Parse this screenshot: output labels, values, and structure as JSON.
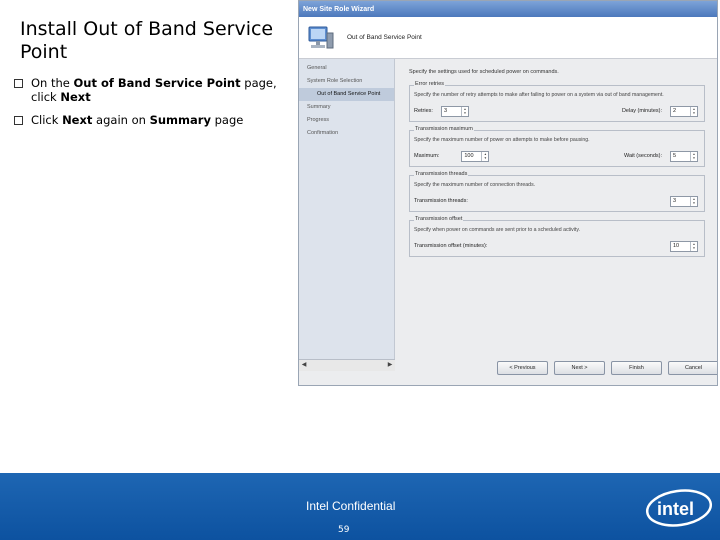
{
  "slide": {
    "title": "Install Out of Band Service Point",
    "bullets": [
      {
        "parts": [
          {
            "text": "On the ",
            "bold": false
          },
          {
            "text": "Out of Band Service Point",
            "bold": true
          },
          {
            "text": " page, click ",
            "bold": false
          },
          {
            "text": "Next",
            "bold": true
          }
        ]
      },
      {
        "parts": [
          {
            "text": "Click ",
            "bold": false
          },
          {
            "text": "Next",
            "bold": true
          },
          {
            "text": " again on ",
            "bold": false
          },
          {
            "text": "Summary",
            "bold": true
          },
          {
            "text": " page",
            "bold": false
          }
        ]
      }
    ]
  },
  "wizard": {
    "window_title": "New Site Role Wizard",
    "header_title": "Out of Band Service Point",
    "nav": [
      {
        "label": "General",
        "active": false,
        "sub": false
      },
      {
        "label": "System Role Selection",
        "active": false,
        "sub": false
      },
      {
        "label": "Out of Band Service Point",
        "active": true,
        "sub": true
      },
      {
        "label": "Summary",
        "active": false,
        "sub": false
      },
      {
        "label": "Progress",
        "active": false,
        "sub": false
      },
      {
        "label": "Confirmation",
        "active": false,
        "sub": false
      }
    ],
    "intro": "Specify the settings used for scheduled power on commands.",
    "groups": {
      "error_retries": {
        "label": "Error retries",
        "desc": "Specify the number of retry attempts to make after failing to power on a system via out of band management.",
        "retries_label": "Retries:",
        "retries_value": "3",
        "delay_label": "Delay (minutes):",
        "delay_value": "2"
      },
      "transmission_maximum": {
        "label": "Transmission maximum",
        "desc": "Specify the maximum number of power on attempts to make before pausing.",
        "maximum_label": "Maximum:",
        "maximum_value": "100",
        "wait_label": "Wait (seconds):",
        "wait_value": "5"
      },
      "transmission_threads": {
        "label": "Transmission threads",
        "desc": "Specify the maximum number of connection threads.",
        "threads_label": "Transmission threads:",
        "threads_value": "3"
      },
      "transmission_offset": {
        "label": "Transmission offset",
        "desc": "Specify when power on commands are sent prior to a scheduled activity.",
        "offset_label": "Transmission offset (minutes):",
        "offset_value": "10"
      }
    },
    "buttons": {
      "previous": "< Previous",
      "next": "Next >",
      "finish": "Finish",
      "cancel": "Cancel"
    }
  },
  "footer": {
    "confidential": "Intel Confidential",
    "page_number": "59",
    "logo_text": "intel"
  },
  "colors": {
    "footer_bg": "#1060b0",
    "titlebar": "#4c78bc",
    "nav_active": "#bfcbdc"
  }
}
